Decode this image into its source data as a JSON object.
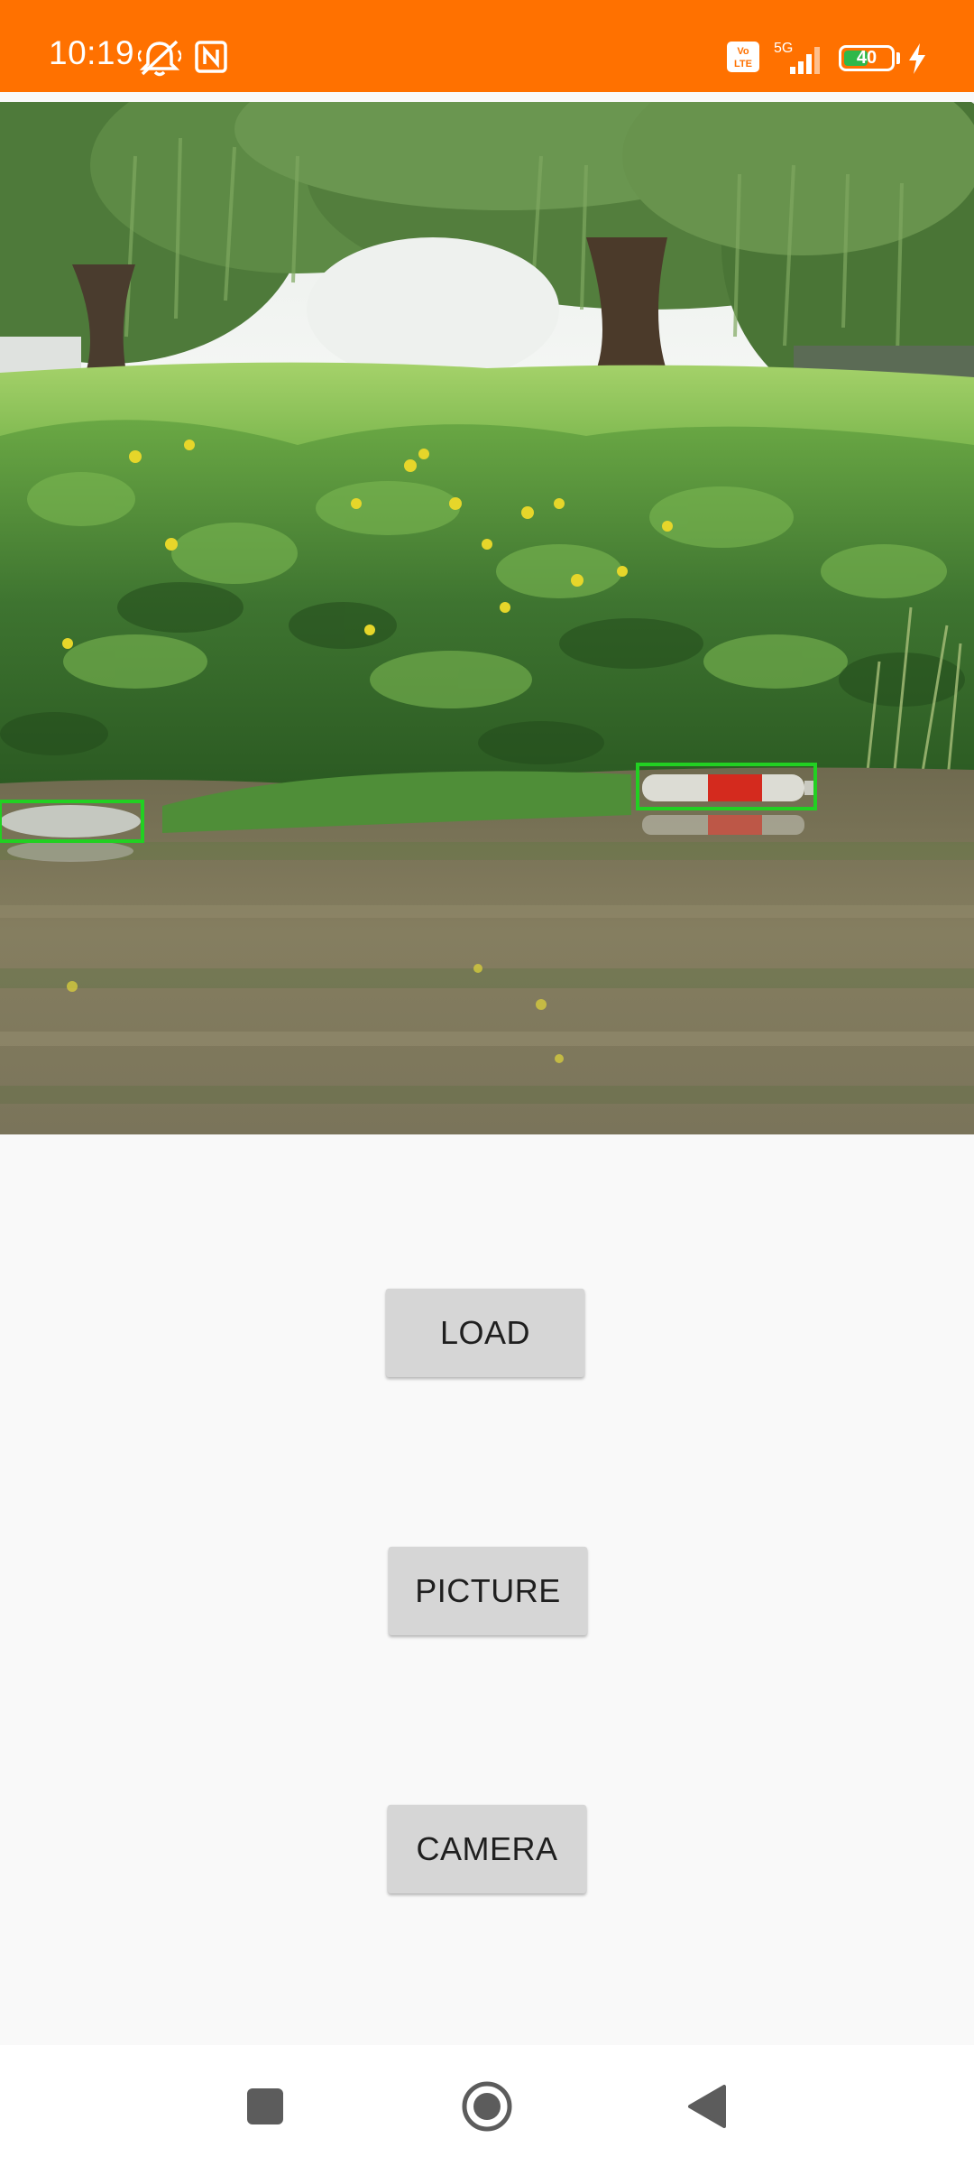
{
  "status_bar": {
    "time": "10:19",
    "battery_level": "40",
    "network": "5G",
    "volte": "Vo LTE",
    "background_color": "#ff7100",
    "icons": [
      "muted-vibrate-icon",
      "nfc-icon",
      "volte-icon",
      "signal-icon",
      "battery-icon",
      "charging-icon"
    ]
  },
  "photo": {
    "description_icon": "detection-image",
    "box_color": "#22d022"
  },
  "buttons": {
    "load_label": "LOAD",
    "picture_label": "PICTURE",
    "camera_label": "CAMERA"
  },
  "nav_bar": {
    "icons": [
      "recents-icon",
      "home-icon",
      "back-icon"
    ]
  }
}
